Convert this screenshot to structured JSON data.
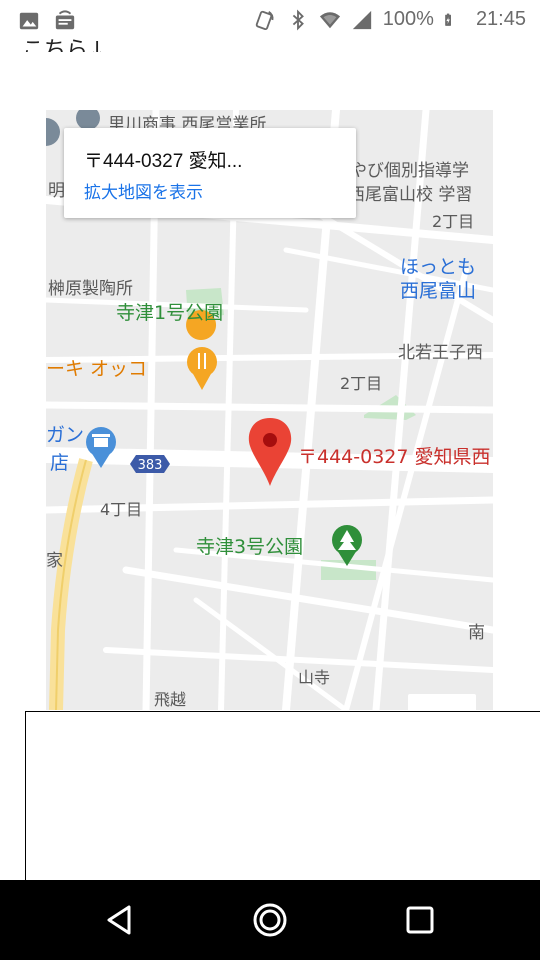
{
  "status_bar": {
    "battery": "100%",
    "time": "21:45",
    "icons_left": [
      "gallery-icon",
      "wireless-display-icon"
    ],
    "icons_right": [
      "nfc-icon",
      "bluetooth-icon",
      "wifi-icon",
      "signal-icon",
      "battery-charging-icon"
    ]
  },
  "page": {
    "cut_text": "こちら↓"
  },
  "map": {
    "info_title": "〒444-0327 愛知...",
    "info_link": "拡大地図を表示",
    "labels": {
      "top_business": "里川商事 西尾営業所",
      "left_edge": "明",
      "top_right_school1": "やび個別指導学",
      "top_right_school2": "西尾富山校 学習",
      "chome2_top": "2丁目",
      "factory": "榊原製陶所",
      "park1": "寺津1号公園",
      "hottomo1": "ほっとも",
      "hottomo2": "西尾富山",
      "cake": "ーキ オッコ",
      "kita_wakaoji": "北若王子西",
      "chome2_mid": "2丁目",
      "gan": "ガン",
      "shop": "店",
      "route": "383",
      "marker_label": "〒444-0327 愛知県西",
      "chome4": "4丁目",
      "park3": "寺津3号公園",
      "ie": "家",
      "minami": "南",
      "yamadera": "山寺",
      "hiketsu": "飛越"
    }
  },
  "colors": {
    "map_bg": "#eeeeee",
    "road": "#ffffff",
    "park": "#c8e6c9",
    "highway": "#f9e19a",
    "marker": "#ea4335",
    "link": "#1a73e8",
    "nav_bg": "#000000"
  },
  "nav": {
    "back": "back-icon",
    "home": "home-icon",
    "recents": "recents-icon"
  }
}
